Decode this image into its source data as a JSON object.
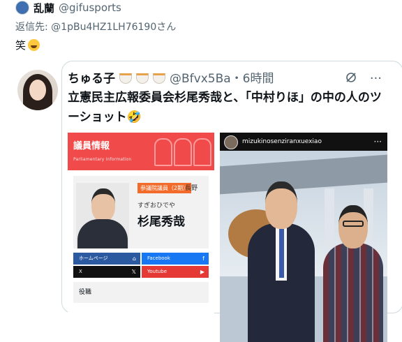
{
  "reply_tweet": {
    "display_name": "乱蘭",
    "handle": "@gifusports",
    "reply_to_label": "返信先: @1pBu4HZ1LH76190さん",
    "text": "笑",
    "text_emoji": "grinning-squint-face"
  },
  "quoted_tweet": {
    "display_name": "ちゅる子",
    "name_emoji": "ramen-bowl",
    "handle_time": "@Bfvx5Ba・6時間",
    "more_label": "···",
    "text": "立憲民主広報委員会杉尾秀哉と、「中村りほ」の中の人のツーショット🤣"
  },
  "left_image": {
    "header_title": "議員情報",
    "header_subtitle": "Parliamentary Information",
    "badge": "参議院議員（2期）",
    "region": "長野",
    "name_kana": "すぎおひでや",
    "name": "杉尾秀哉",
    "links": [
      {
        "label": "ホームページ",
        "icon": "⌂",
        "color": "#2c5aa0"
      },
      {
        "label": "Facebook",
        "icon": "f",
        "color": "#1877f2"
      },
      {
        "label": "X",
        "icon": "𝕏",
        "color": "#111111"
      },
      {
        "label": "Youtube",
        "icon": "▶",
        "color": "#e53935"
      }
    ],
    "role_label": "役職"
  },
  "right_image": {
    "username": "mizukinosenziranxuexiao",
    "menu": "···"
  }
}
